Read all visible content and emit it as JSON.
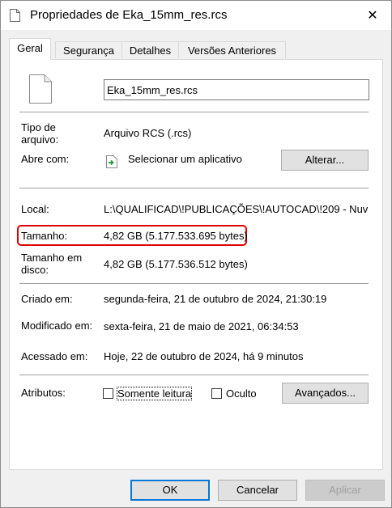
{
  "window": {
    "title": "Propriedades de Eka_15mm_res.rcs",
    "close_glyph": "✕"
  },
  "tabs": [
    {
      "label": "Geral",
      "active": true
    },
    {
      "label": "Segurança",
      "active": false
    },
    {
      "label": "Detalhes",
      "active": false
    },
    {
      "label": "Versões Anteriores",
      "active": false
    }
  ],
  "general": {
    "filename": "Eka_15mm_res.rcs",
    "type_label": "Tipo de arquivo:",
    "type_value": "Arquivo RCS (.rcs)",
    "opens_with_label": "Abre com:",
    "opens_with_value": "Selecionar um aplicativo",
    "change_button": "Alterar...",
    "location_label": "Local:",
    "location_value": "L:\\QUALIFICAD\\!PUBLICAÇÕES\\!AUTOCAD\\!209 - Nuv",
    "size_label": "Tamanho:",
    "size_value": "4,82 GB (5.177.533.695 bytes)",
    "size_on_disk_label": "Tamanho em disco:",
    "size_on_disk_value": "4,82 GB (5.177.536.512 bytes)",
    "created_label": "Criado em:",
    "created_value": "segunda-feira, 21 de outubro de 2024, 21:30:19",
    "modified_label": "Modificado em:",
    "modified_value": "sexta-feira, 21 de maio de 2021, 06:34:53",
    "accessed_label": "Acessado em:",
    "accessed_value": "Hoje, 22 de outubro de 2024, há 9 minutos",
    "attributes_label": "Atributos:",
    "readonly_label": "Somente leitura",
    "readonly_checked": false,
    "hidden_label": "Oculto",
    "hidden_checked": false,
    "advanced_button": "Avançados..."
  },
  "footer": {
    "ok": "OK",
    "cancel": "Cancelar",
    "apply": "Aplicar"
  },
  "colors": {
    "highlight": "#e00000",
    "accent": "#0078d7"
  }
}
